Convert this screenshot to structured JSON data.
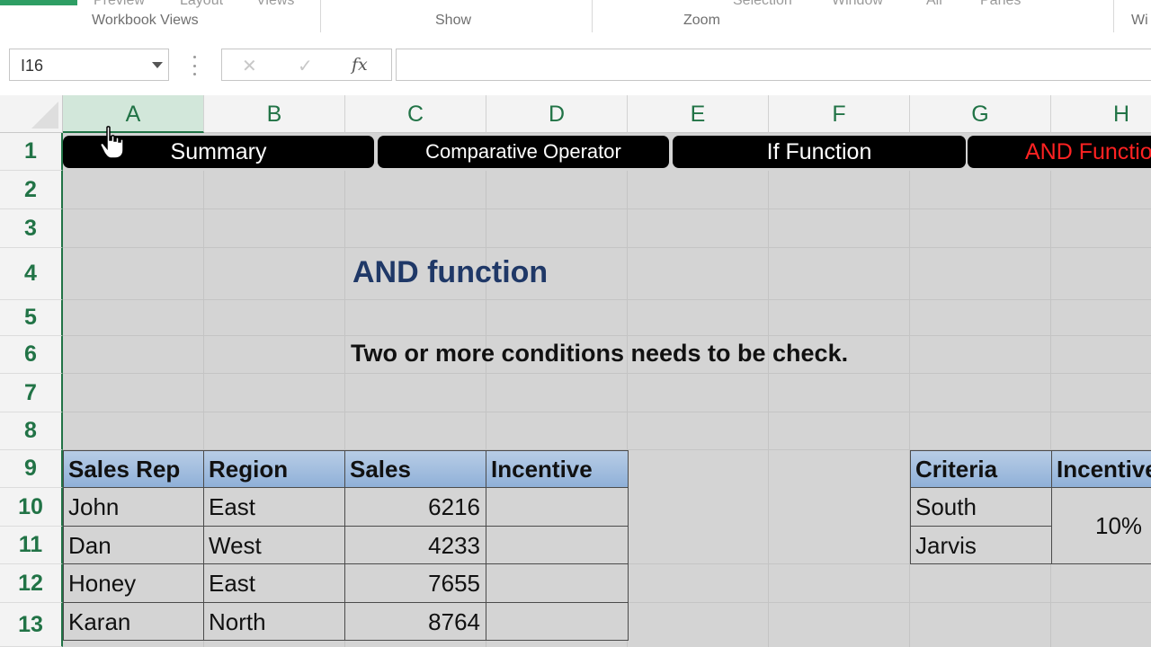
{
  "ribbon": {
    "top_items": [
      "Preview",
      "Layout",
      "Views",
      "Selection",
      "Window",
      "All",
      "Panes"
    ],
    "groups": [
      "Workbook Views",
      "Show",
      "Zoom",
      "Wi"
    ]
  },
  "formula_bar": {
    "name_box": "I16",
    "cancel_symbol": "✕",
    "enter_symbol": "✓",
    "fx_symbol": "fx",
    "formula": ""
  },
  "grid": {
    "columns": [
      "A",
      "B",
      "C",
      "D",
      "E",
      "F",
      "G",
      "H"
    ],
    "rows": [
      "1",
      "2",
      "3",
      "4",
      "5",
      "6",
      "7",
      "8",
      "9",
      "10",
      "11",
      "12",
      "13"
    ],
    "selected_column": "A"
  },
  "nav_buttons": [
    "Summary",
    "Comparative Operator",
    "If Function",
    "AND Function"
  ],
  "content": {
    "title": "AND function",
    "subtitle": "Two or more conditions needs to be check."
  },
  "sales_table": {
    "headers": [
      "Sales Rep",
      "Region",
      "Sales",
      "Incentive"
    ],
    "rows": [
      [
        "John",
        "East",
        "6216",
        ""
      ],
      [
        "Dan",
        "West",
        "4233",
        ""
      ],
      [
        "Honey",
        "East",
        "7655",
        ""
      ],
      [
        "Karan",
        "North",
        "8764",
        ""
      ]
    ]
  },
  "criteria_table": {
    "headers": [
      "Criteria",
      "Incentive"
    ],
    "rows": [
      "South",
      "Jarvis"
    ],
    "incentive_value": "10%"
  },
  "colors": {
    "excel_green": "#217346",
    "header_blue": "#8fb0d8",
    "title_navy": "#1f3867",
    "active_nav_red": "#ff2222"
  }
}
